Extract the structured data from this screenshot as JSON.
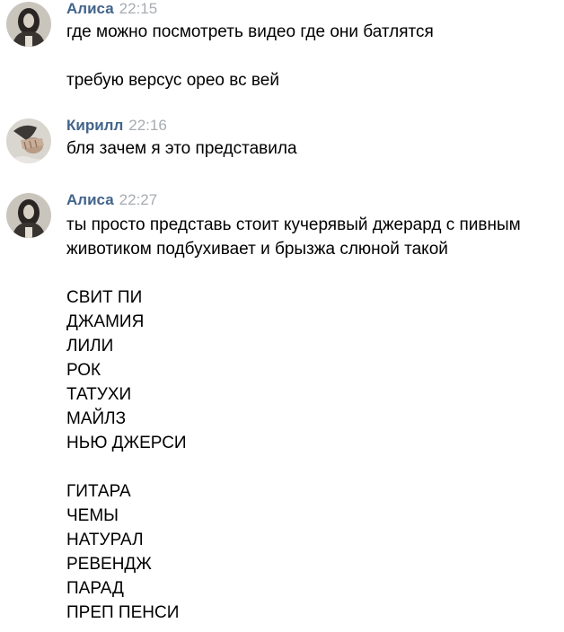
{
  "messages": [
    {
      "author": "Алиса",
      "time": "22:15",
      "avatar": "avatar-alisa",
      "lines": [
        "где можно посмотреть видео где они батлятся",
        "",
        "требую версус орео вс вей"
      ]
    },
    {
      "author": "Кирилл",
      "time": "22:16",
      "avatar": "avatar-kirill",
      "lines": [
        "бля зачем я это представила"
      ]
    },
    {
      "author": "Алиса",
      "time": "22:27",
      "avatar": "avatar-alisa",
      "lines": [
        "ты просто представь стоит кучерявый джерард с пивным",
        "животиком подбухивает и брызжа слюной такой",
        "",
        "СВИТ ПИ",
        "ДЖАМИЯ",
        "ЛИЛИ",
        "РОК",
        "ТАТУХИ",
        "МАЙЛЗ",
        "НЬЮ ДЖЕРСИ",
        "",
        "ГИТАРА",
        "ЧЕМЫ",
        "НАТУРАЛ",
        "РЕВЕНДЖ",
        "ПАРАД",
        "ПРЕП ПЕНСИ"
      ]
    }
  ],
  "colors": {
    "author": "#42648b",
    "time": "#a8acb1",
    "text": "#000000"
  }
}
